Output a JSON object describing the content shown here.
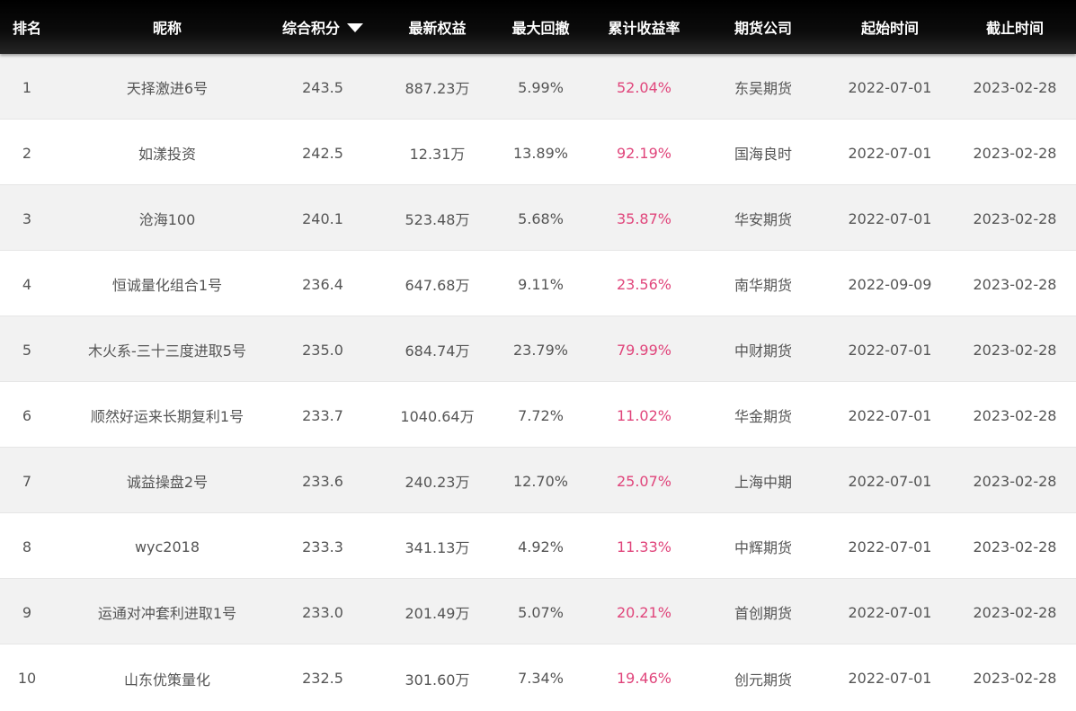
{
  "header": {
    "rank": "排名",
    "name": "昵称",
    "score": "综合积分",
    "equity": "最新权益",
    "drawdown": "最大回撤",
    "return": "累计收益率",
    "company": "期货公司",
    "start": "起始时间",
    "end": "截止时间",
    "sort_icon": "triangle-down-icon"
  },
  "colors": {
    "header_bg": "#000000",
    "header_text": "#ffffff",
    "row_alt_bg": "#f2f2f2",
    "text": "#555555",
    "positive_return": "#e0457b"
  },
  "rows": [
    {
      "rank": "1",
      "name": "天择激进6号",
      "score": "243.5",
      "equity": "887.23万",
      "drawdown": "5.99%",
      "return": "52.04%",
      "company": "东吴期货",
      "start": "2022-07-01",
      "end": "2023-02-28"
    },
    {
      "rank": "2",
      "name": "如漾投资",
      "score": "242.5",
      "equity": "12.31万",
      "drawdown": "13.89%",
      "return": "92.19%",
      "company": "国海良时",
      "start": "2022-07-01",
      "end": "2023-02-28"
    },
    {
      "rank": "3",
      "name": "沧海100",
      "score": "240.1",
      "equity": "523.48万",
      "drawdown": "5.68%",
      "return": "35.87%",
      "company": "华安期货",
      "start": "2022-07-01",
      "end": "2023-02-28"
    },
    {
      "rank": "4",
      "name": "恒诚量化组合1号",
      "score": "236.4",
      "equity": "647.68万",
      "drawdown": "9.11%",
      "return": "23.56%",
      "company": "南华期货",
      "start": "2022-09-09",
      "end": "2023-02-28"
    },
    {
      "rank": "5",
      "name": "木火系-三十三度进取5号",
      "score": "235.0",
      "equity": "684.74万",
      "drawdown": "23.79%",
      "return": "79.99%",
      "company": "中财期货",
      "start": "2022-07-01",
      "end": "2023-02-28"
    },
    {
      "rank": "6",
      "name": "顺然好运来长期复利1号",
      "score": "233.7",
      "equity": "1040.64万",
      "drawdown": "7.72%",
      "return": "11.02%",
      "company": "华金期货",
      "start": "2022-07-01",
      "end": "2023-02-28"
    },
    {
      "rank": "7",
      "name": "诚益操盘2号",
      "score": "233.6",
      "equity": "240.23万",
      "drawdown": "12.70%",
      "return": "25.07%",
      "company": "上海中期",
      "start": "2022-07-01",
      "end": "2023-02-28"
    },
    {
      "rank": "8",
      "name": "wyc2018",
      "score": "233.3",
      "equity": "341.13万",
      "drawdown": "4.92%",
      "return": "11.33%",
      "company": "中辉期货",
      "start": "2022-07-01",
      "end": "2023-02-28"
    },
    {
      "rank": "9",
      "name": "运通对冲套利进取1号",
      "score": "233.0",
      "equity": "201.49万",
      "drawdown": "5.07%",
      "return": "20.21%",
      "company": "首创期货",
      "start": "2022-07-01",
      "end": "2023-02-28"
    },
    {
      "rank": "10",
      "name": "山东优策量化",
      "score": "232.5",
      "equity": "301.60万",
      "drawdown": "7.34%",
      "return": "19.46%",
      "company": "创元期货",
      "start": "2022-07-01",
      "end": "2023-02-28"
    }
  ]
}
